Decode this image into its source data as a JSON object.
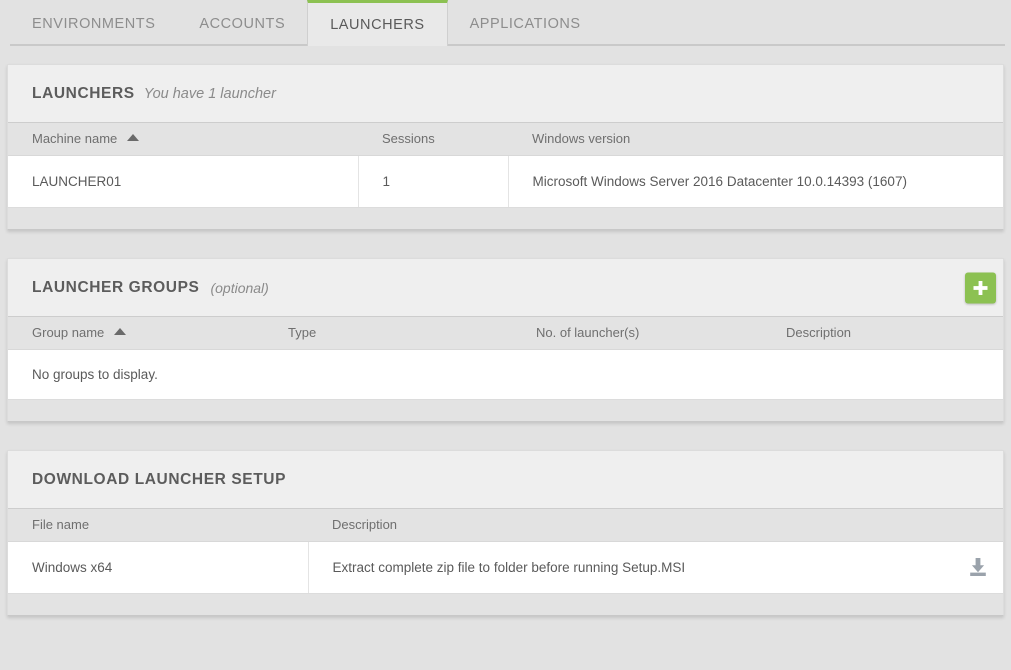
{
  "tabs": [
    {
      "label": "ENVIRONMENTS",
      "active": false
    },
    {
      "label": "ACCOUNTS",
      "active": false
    },
    {
      "label": "LAUNCHERS",
      "active": true
    },
    {
      "label": "APPLICATIONS",
      "active": false
    }
  ],
  "colors": {
    "accent_green": "#8cc152",
    "page_background": "#e2e2e2",
    "panel_background": "#efefef",
    "row_background": "#ffffff",
    "header_text": "#5c5c5c",
    "muted_text": "#8a8a8a"
  },
  "launchers_panel": {
    "title": "LAUNCHERS",
    "subtitle": "You have 1 launcher",
    "columns": [
      "Machine name",
      "Sessions",
      "Windows version"
    ],
    "sort_column": "Machine name",
    "sort_direction": "ascending",
    "rows": [
      {
        "machine_name": "LAUNCHER01",
        "sessions": "1",
        "windows_version": "Microsoft Windows Server 2016 Datacenter 10.0.14393 (1607)"
      }
    ]
  },
  "launcher_groups_panel": {
    "title": "LAUNCHER GROUPS",
    "subtitle": "(optional)",
    "add_button_icon": "plus-icon",
    "columns": [
      "Group name",
      "Type",
      "No. of launcher(s)",
      "Description"
    ],
    "sort_column": "Group name",
    "sort_direction": "ascending",
    "empty_message": "No groups to display."
  },
  "download_panel": {
    "title": "DOWNLOAD LAUNCHER SETUP",
    "columns": [
      "File name",
      "Description"
    ],
    "rows": [
      {
        "file_name": "Windows x64",
        "description": "Extract complete zip file to folder before running Setup.MSI",
        "action_icon": "download-icon"
      }
    ]
  }
}
